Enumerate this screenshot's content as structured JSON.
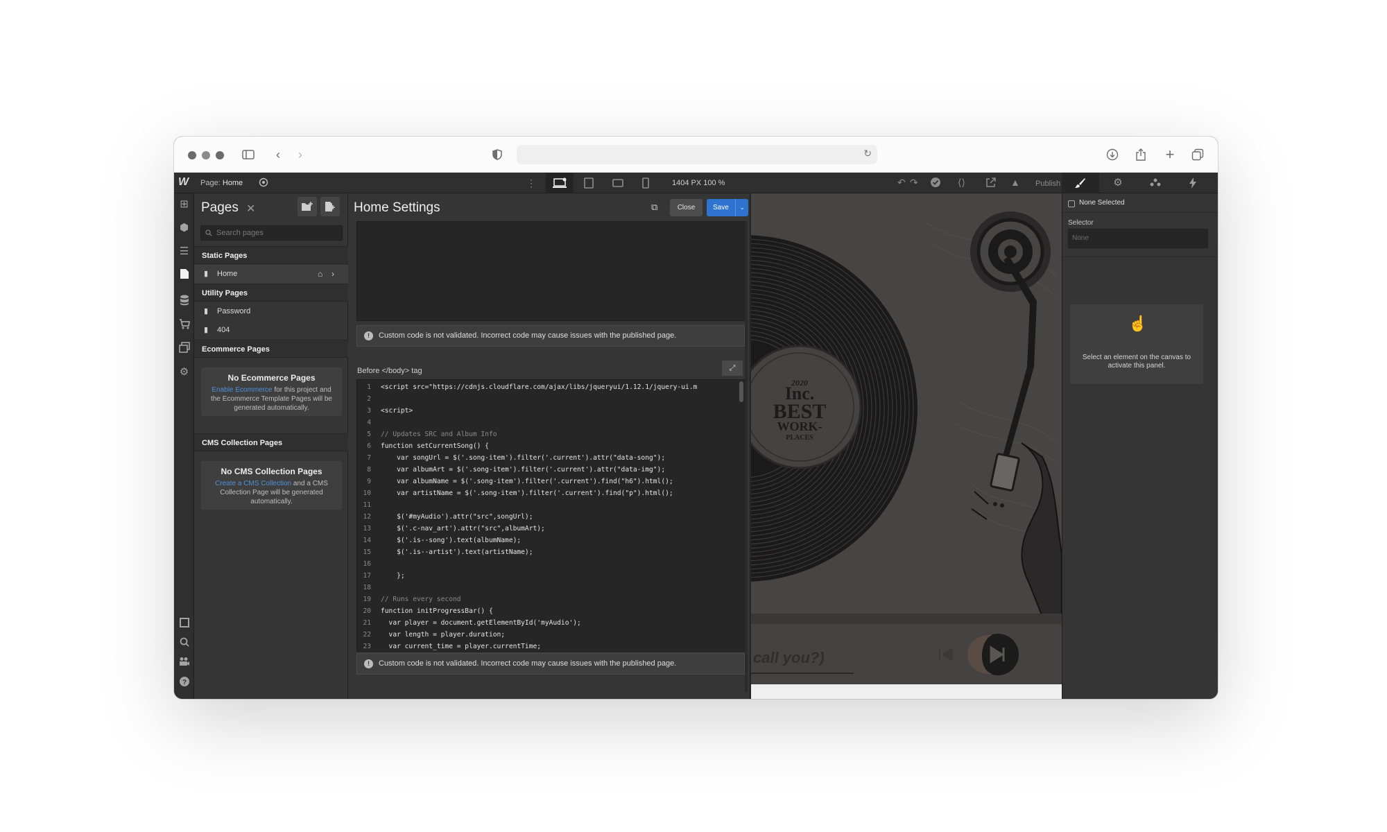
{
  "pages_panel": {
    "title": "Pages",
    "search_placeholder": "Search pages",
    "static_label": "Static Pages",
    "static_pages": [
      "Home"
    ],
    "utility_label": "Utility Pages",
    "utility_pages": [
      "Password",
      "404"
    ],
    "ecommerce_label": "Ecommerce Pages",
    "ecommerce_empty": {
      "title": "No Ecommerce Pages",
      "link": "Enable Ecommerce",
      "text": " for this project and the Ecommerce Template Pages will be generated automatically."
    },
    "cms_label": "CMS Collection Pages",
    "cms_empty": {
      "title": "No CMS Collection Pages",
      "link": "Create a CMS Collection",
      "text": " and a CMS Collection Page will be generated automatically."
    }
  },
  "toolbar": {
    "page_prefix": "Page: ",
    "page_name": "Home",
    "dimensions": "1404 PX  100 %",
    "publish_label": "Publish"
  },
  "settings": {
    "title": "Home Settings",
    "close_label": "Close",
    "save_label": "Save",
    "warning": "Custom code is not validated. Incorrect code may cause issues with the published page.",
    "before_body_label": "Before </body> tag",
    "code_lines": [
      {
        "n": "1",
        "t": "<script src=\"https://cdnjs.cloudflare.com/ajax/libs/jqueryui/1.12.1/jquery-ui.m"
      },
      {
        "n": "2",
        "t": ""
      },
      {
        "n": "3",
        "t": "<script>"
      },
      {
        "n": "4",
        "t": ""
      },
      {
        "n": "5",
        "t": "// Updates SRC and Album Info"
      },
      {
        "n": "6",
        "t": "function setCurrentSong() {"
      },
      {
        "n": "7",
        "t": "    var songUrl = $('.song-item').filter('.current').attr(\"data-song\");"
      },
      {
        "n": "8",
        "t": "    var albumArt = $('.song-item').filter('.current').attr(\"data-img\");"
      },
      {
        "n": "9",
        "t": "    var albumName = $('.song-item').filter('.current').find(\"h6\").html();"
      },
      {
        "n": "10",
        "t": "    var artistName = $('.song-item').filter('.current').find(\"p\").html();"
      },
      {
        "n": "11",
        "t": ""
      },
      {
        "n": "12",
        "t": "    $('#myAudio').attr(\"src\",songUrl);"
      },
      {
        "n": "13",
        "t": "    $('.c-nav_art').attr(\"src\",albumArt);"
      },
      {
        "n": "14",
        "t": "    $('.is--song').text(albumName);"
      },
      {
        "n": "15",
        "t": "    $('.is--artist').text(artistName);"
      },
      {
        "n": "16",
        "t": ""
      },
      {
        "n": "17",
        "t": "    };"
      },
      {
        "n": "18",
        "t": ""
      },
      {
        "n": "19",
        "t": "// Runs every second"
      },
      {
        "n": "20",
        "t": "function initProgressBar() {"
      },
      {
        "n": "21",
        "t": "  var player = document.getElementById('myAudio');"
      },
      {
        "n": "22",
        "t": "  var length = player.duration;"
      },
      {
        "n": "23",
        "t": "  var current_time = player.currentTime;"
      }
    ]
  },
  "canvas": {
    "badge_year": "2020",
    "badge_brand": "Inc.",
    "badge_line1": "BEST",
    "badge_line2": "WORK-",
    "badge_line3": "PLACES",
    "player_text": "call you?)"
  },
  "style_panel": {
    "none_selected": "None Selected",
    "selector_label": "Selector",
    "selector_placeholder": "None",
    "hint": "Select an element on the canvas to activate this panel."
  },
  "colors": {
    "accent": "#2f73d1",
    "panel": "#353535",
    "link": "#4f91d9"
  }
}
